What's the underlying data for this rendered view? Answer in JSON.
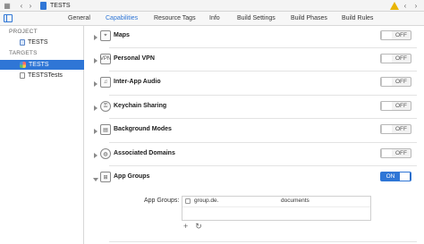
{
  "topbar": {
    "breadcrumb": "TESTS",
    "nav_back": "‹",
    "nav_forward": "›",
    "grid_icon": "grid-icon",
    "warning_icon": "warning-icon",
    "nav_right_back": "‹",
    "nav_right_forward": "›"
  },
  "tabs": [
    {
      "label": "General",
      "active": false
    },
    {
      "label": "Capabilities",
      "active": true
    },
    {
      "label": "Resource Tags",
      "active": false
    },
    {
      "label": "Info",
      "active": false
    },
    {
      "label": "Build Settings",
      "active": false
    },
    {
      "label": "Build Phases",
      "active": false
    },
    {
      "label": "Build Rules",
      "active": false
    }
  ],
  "sidebar": {
    "project_header": "PROJECT",
    "project_item": "TESTS",
    "targets_header": "TARGETS",
    "targets": [
      {
        "label": "TESTS",
        "selected": true
      },
      {
        "label": "TESTSTests",
        "selected": false
      }
    ]
  },
  "capabilities": [
    {
      "label": "Maps",
      "icon": "maps-icon",
      "state": "OFF",
      "expanded": false
    },
    {
      "label": "Personal VPN",
      "icon": "vpn-icon",
      "state": "OFF",
      "expanded": false
    },
    {
      "label": "Inter-App Audio",
      "icon": "audio-icon",
      "state": "OFF",
      "expanded": false
    },
    {
      "label": "Keychain Sharing",
      "icon": "key-icon",
      "state": "OFF",
      "expanded": false
    },
    {
      "label": "Background Modes",
      "icon": "background-modes-icon",
      "state": "OFF",
      "expanded": false
    },
    {
      "label": "Associated Domains",
      "icon": "globe-icon",
      "state": "OFF",
      "expanded": false
    },
    {
      "label": "App Groups",
      "icon": "app-groups-icon",
      "state": "ON",
      "expanded": true
    }
  ],
  "app_groups": {
    "label": "App Groups:",
    "group_prefix": "group.de.",
    "group_suffix": "documents",
    "add_label": "+",
    "refresh_label": "↻"
  },
  "colors": {
    "accent": "#2f76d6",
    "warning": "#e8b400"
  }
}
